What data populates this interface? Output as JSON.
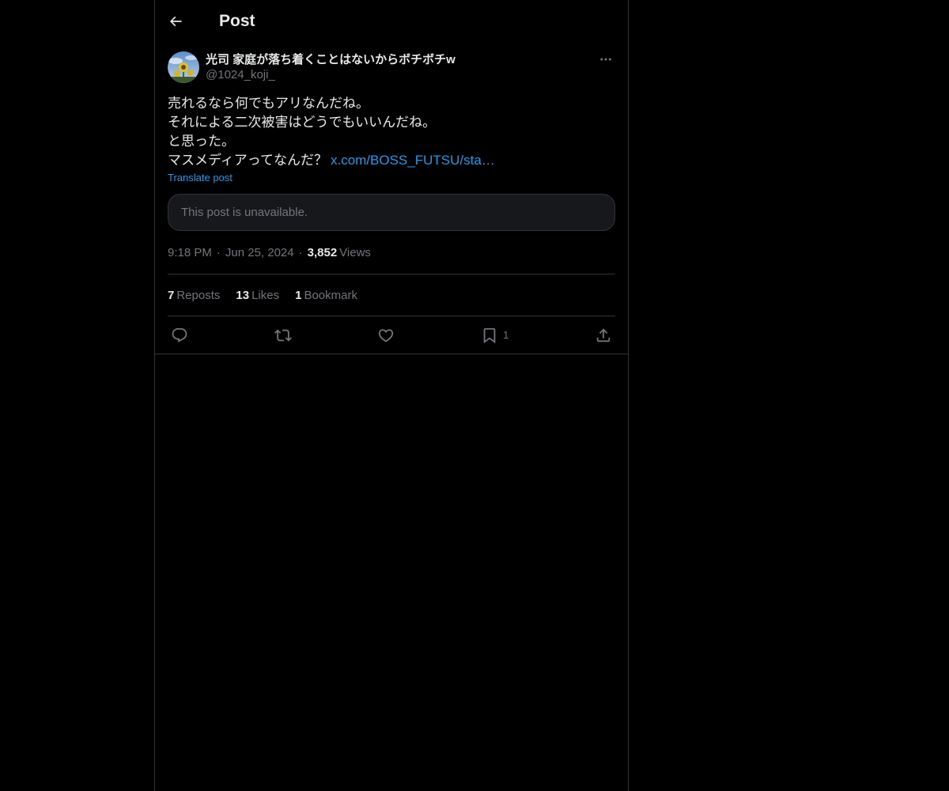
{
  "header": {
    "title": "Post"
  },
  "post": {
    "author": {
      "display_name": "光司 家庭が落ち着くことはないからボチボチw",
      "handle": "@1024_koji_"
    },
    "body_lines": [
      "売れるなら何でもアリなんだね。",
      "それによる二次被害はどうでもいいんだね。",
      "と思った。",
      "マスメディアってなんだ？"
    ],
    "link_text": "x.com/BOSS_FUTSU/sta…",
    "translate_label": "Translate post",
    "quote_unavailable": "This post is unavailable.",
    "time": "9:18 PM",
    "date": "Jun 25, 2024",
    "views_count": "3,852",
    "views_label": "Views",
    "stats": {
      "reposts_count": "7",
      "reposts_label": "Reposts",
      "likes_count": "13",
      "likes_label": "Likes",
      "bookmarks_count": "1",
      "bookmarks_label": "Bookmark"
    },
    "actions": {
      "reply_icon": "reply-icon",
      "repost_icon": "repost-icon",
      "like_icon": "heart-icon",
      "bookmark_icon": "bookmark-icon",
      "bookmark_count": "1",
      "share_icon": "share-icon"
    }
  },
  "colors": {
    "background": "#000000",
    "text": "#e7e9ea",
    "secondary": "#71767b",
    "accent": "#1d9bf0",
    "border": "#2f3336"
  }
}
